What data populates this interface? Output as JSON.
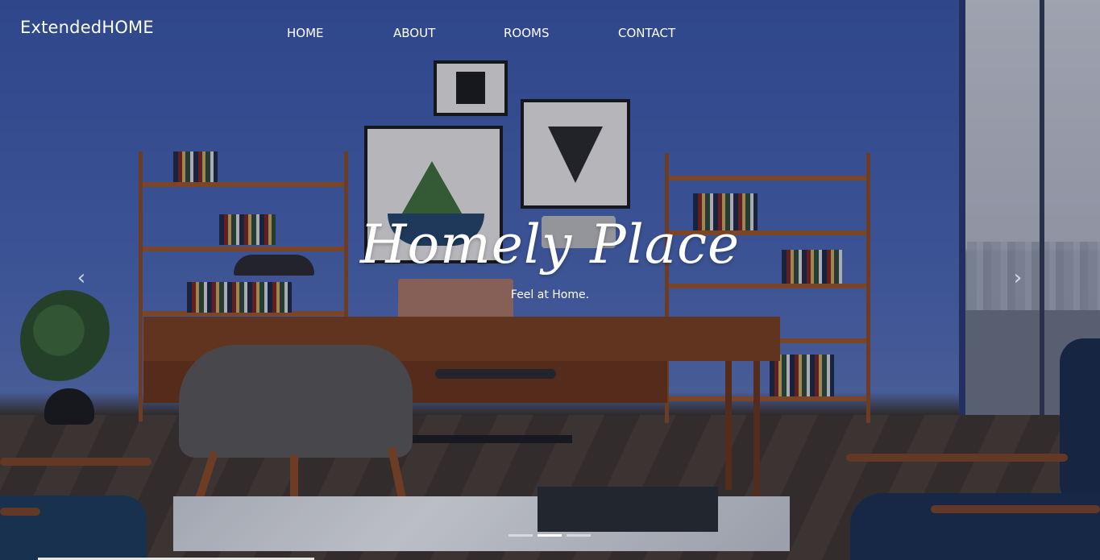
{
  "brand": {
    "name": "ExtendedHOME"
  },
  "nav": {
    "items": [
      {
        "label": "HOME"
      },
      {
        "label": "ABOUT"
      },
      {
        "label": "ROOMS"
      },
      {
        "label": "CONTACT"
      }
    ]
  },
  "hero": {
    "title": "Homely Place",
    "subtitle": "Feel at Home.",
    "prev_icon": "chevron-left-icon",
    "next_icon": "chevron-right-icon",
    "slide_count": 3,
    "active_slide": 2
  },
  "colors": {
    "nav_text": "#ffffff",
    "indicator_active": "#ffffff",
    "indicator_inactive": "rgba(255,255,255,0.5)"
  }
}
